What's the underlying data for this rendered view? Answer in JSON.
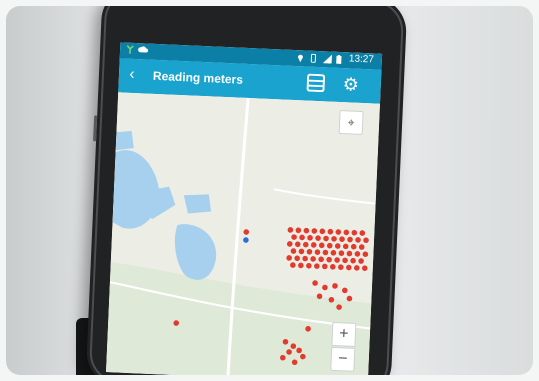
{
  "status_bar": {
    "time": "13:27",
    "left_icons": [
      "signal-app-icon",
      "cloud-icon"
    ],
    "right_icons": [
      "location-pin-icon",
      "vibrate-icon",
      "cell-signal-icon",
      "battery-icon"
    ]
  },
  "app_bar": {
    "title": "Reading meters",
    "back_icon": "chevron-left-icon",
    "list_icon": "list-icon",
    "settings_icon": "gear-icon"
  },
  "map": {
    "zoom_in_label": "+",
    "zoom_out_label": "−",
    "marker_color": "#e23b2e",
    "selected_marker_color": "#2b6fd6",
    "water_color": "#a6d0ee",
    "park_color": "#d5e7cf"
  }
}
